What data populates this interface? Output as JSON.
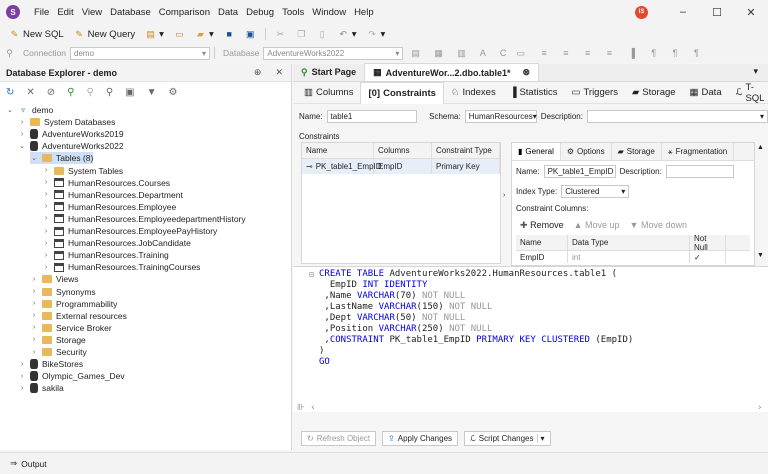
{
  "menu": [
    "File",
    "Edit",
    "View",
    "Database",
    "Comparison",
    "Data",
    "Debug",
    "Tools",
    "Window",
    "Help"
  ],
  "user_initials": "IS",
  "toolbar1": {
    "new_sql": "New SQL",
    "new_query": "New Query"
  },
  "toolbar2": {
    "connection_label": "Connection",
    "connection_value": "demo",
    "database_label": "Database",
    "database_value": "AdventureWorks2022"
  },
  "explorer": {
    "title": "Database Explorer - demo",
    "tree": [
      {
        "label": "demo",
        "level": 0,
        "icon": "server",
        "open": true
      },
      {
        "label": "System Databases",
        "level": 1,
        "icon": "folder"
      },
      {
        "label": "AdventureWorks2019",
        "level": 1,
        "icon": "db"
      },
      {
        "label": "AdventureWorks2022",
        "level": 1,
        "icon": "db",
        "open": true
      },
      {
        "label": "Tables (8)",
        "level": 2,
        "icon": "folder",
        "open": true,
        "selected": true
      },
      {
        "label": "System Tables",
        "level": 3,
        "icon": "folder"
      },
      {
        "label": "HumanResources.Courses",
        "level": 3,
        "icon": "table"
      },
      {
        "label": "HumanResources.Department",
        "level": 3,
        "icon": "table"
      },
      {
        "label": "HumanResources.Employee",
        "level": 3,
        "icon": "table"
      },
      {
        "label": "HumanResources.EmployeedepartmentHistory",
        "level": 3,
        "icon": "table"
      },
      {
        "label": "HumanResources.EmployeePayHistory",
        "level": 3,
        "icon": "table"
      },
      {
        "label": "HumanResources.JobCandidate",
        "level": 3,
        "icon": "table"
      },
      {
        "label": "HumanResources.Training",
        "level": 3,
        "icon": "table"
      },
      {
        "label": "HumanResources.TrainingCourses",
        "level": 3,
        "icon": "table"
      },
      {
        "label": "Views",
        "level": 2,
        "icon": "folder"
      },
      {
        "label": "Synonyms",
        "level": 2,
        "icon": "folder"
      },
      {
        "label": "Programmability",
        "level": 2,
        "icon": "folder"
      },
      {
        "label": "External resources",
        "level": 2,
        "icon": "folder"
      },
      {
        "label": "Service Broker",
        "level": 2,
        "icon": "folder"
      },
      {
        "label": "Storage",
        "level": 2,
        "icon": "folder"
      },
      {
        "label": "Security",
        "level": 2,
        "icon": "folder"
      },
      {
        "label": "BikeStores",
        "level": 1,
        "icon": "db"
      },
      {
        "label": "Olympic_Games_Dev",
        "level": 1,
        "icon": "db"
      },
      {
        "label": "sakila",
        "level": 1,
        "icon": "db"
      }
    ]
  },
  "tabs": {
    "start": "Start Page",
    "doc": "AdventureWor...2.dbo.table1*"
  },
  "subtabs": [
    "Columns",
    "Constraints",
    "Indexes",
    "Statistics",
    "Triggers",
    "Storage",
    "Data",
    "T-SQL"
  ],
  "form": {
    "name_label": "Name:",
    "name_value": "table1",
    "schema_label": "Schema:",
    "schema_value": "HumanResources",
    "desc_label": "Description:",
    "constraints_label": "Constraints"
  },
  "cgrid": {
    "headers": [
      "Name",
      "Columns",
      "Constraint Type"
    ],
    "row": [
      "PK_table1_EmpID",
      "EmpID",
      "Primary Key"
    ]
  },
  "rpanel": {
    "tabs": [
      "General",
      "Options",
      "Storage",
      "Fragmentation"
    ],
    "name_label": "Name:",
    "name_value": "PK_table1_EmpID",
    "desc_label": "Description:",
    "index_type_label": "Index Type:",
    "index_type_value": "Clustered",
    "constraint_columns_label": "Constraint Columns:",
    "remove": "Remove",
    "move_up": "Move up",
    "move_down": "Move down",
    "col_headers": [
      "Name",
      "Data Type",
      "Not Null"
    ],
    "row": [
      "EmpID",
      "int"
    ]
  },
  "sql": [
    "CREATE TABLE AdventureWorks2022.HumanResources.table1 (",
    "  EmpID INT IDENTITY",
    " ,Name VARCHAR(70) NOT NULL",
    " ,LastName VARCHAR(150) NOT NULL",
    " ,Dept VARCHAR(50) NOT NULL",
    " ,Position VARCHAR(250) NOT NULL",
    " ,CONSTRAINT PK_table1_EmpID PRIMARY KEY CLUSTERED (EmpID)",
    ")",
    "GO"
  ],
  "bottom": {
    "refresh": "Refresh Object",
    "apply": "Apply Changes",
    "script": "Script Changes"
  },
  "status": {
    "output": "Output"
  }
}
